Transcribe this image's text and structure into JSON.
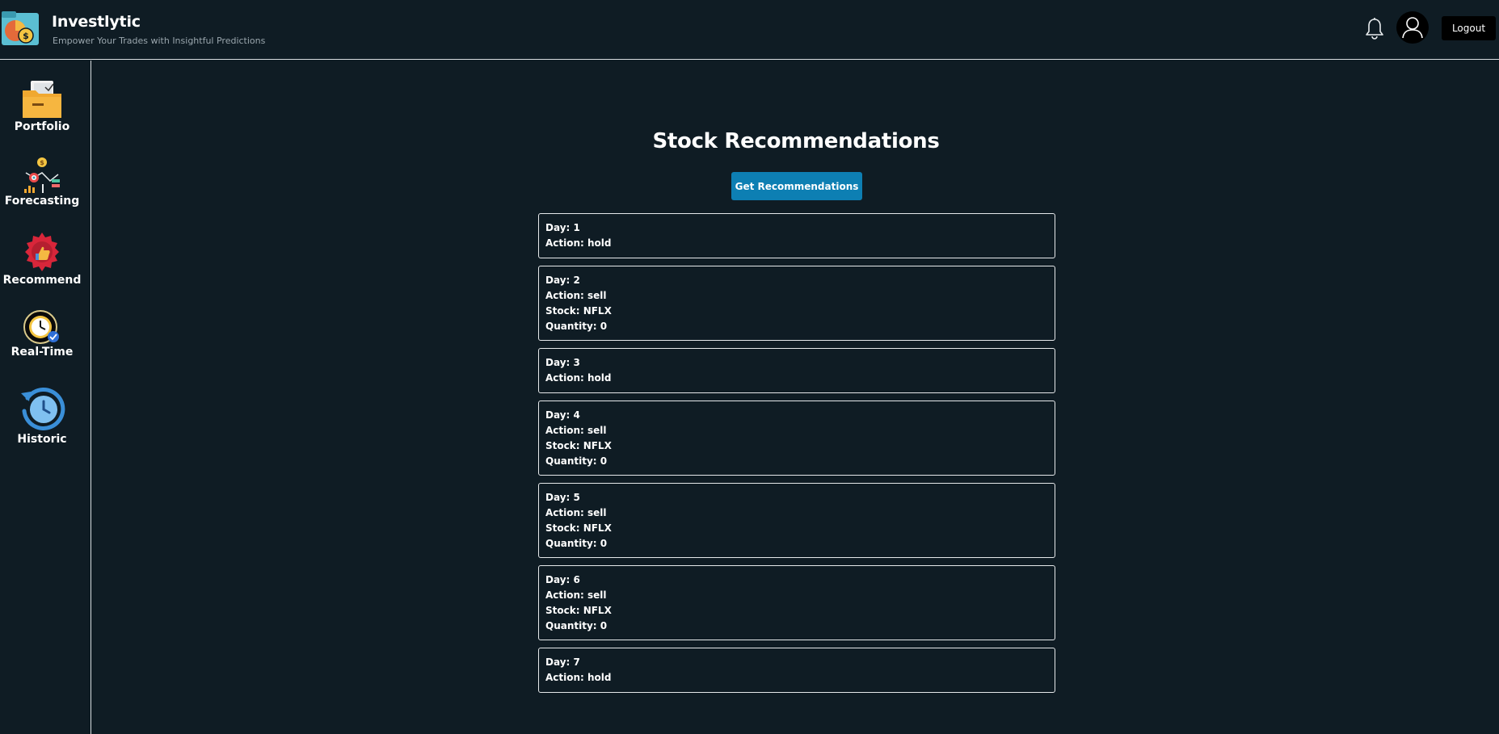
{
  "header": {
    "title": "Investlytic",
    "subtitle": "Empower Your Trades with Insightful Predictions",
    "logout_label": "Logout"
  },
  "sidebar": {
    "items": [
      {
        "label": "Portfolio",
        "icon": "folder-icon"
      },
      {
        "label": "Forecasting",
        "icon": "chart-analysis-icon"
      },
      {
        "label": "Recommend",
        "icon": "badge-thumbs-up-icon"
      },
      {
        "label": "Real-Time",
        "icon": "stopwatch-icon"
      },
      {
        "label": "Historic",
        "icon": "history-clock-icon"
      }
    ]
  },
  "main": {
    "title": "Stock Recommendations",
    "button_label": "Get Recommendations",
    "recommendations": [
      {
        "day": "Day: 1",
        "action": "Action: hold"
      },
      {
        "day": "Day: 2",
        "action": "Action: sell",
        "stock": "Stock: NFLX",
        "quantity": "Quantity: 0"
      },
      {
        "day": "Day: 3",
        "action": "Action: hold"
      },
      {
        "day": "Day: 4",
        "action": "Action: sell",
        "stock": "Stock: NFLX",
        "quantity": "Quantity: 0"
      },
      {
        "day": "Day: 5",
        "action": "Action: sell",
        "stock": "Stock: NFLX",
        "quantity": "Quantity: 0"
      },
      {
        "day": "Day: 6",
        "action": "Action: sell",
        "stock": "Stock: NFLX",
        "quantity": "Quantity: 0"
      },
      {
        "day": "Day: 7",
        "action": "Action: hold"
      }
    ]
  },
  "colors": {
    "background": "#0f1c24",
    "accent_button": "#0d7fb3",
    "border": "#e6e9eb"
  }
}
